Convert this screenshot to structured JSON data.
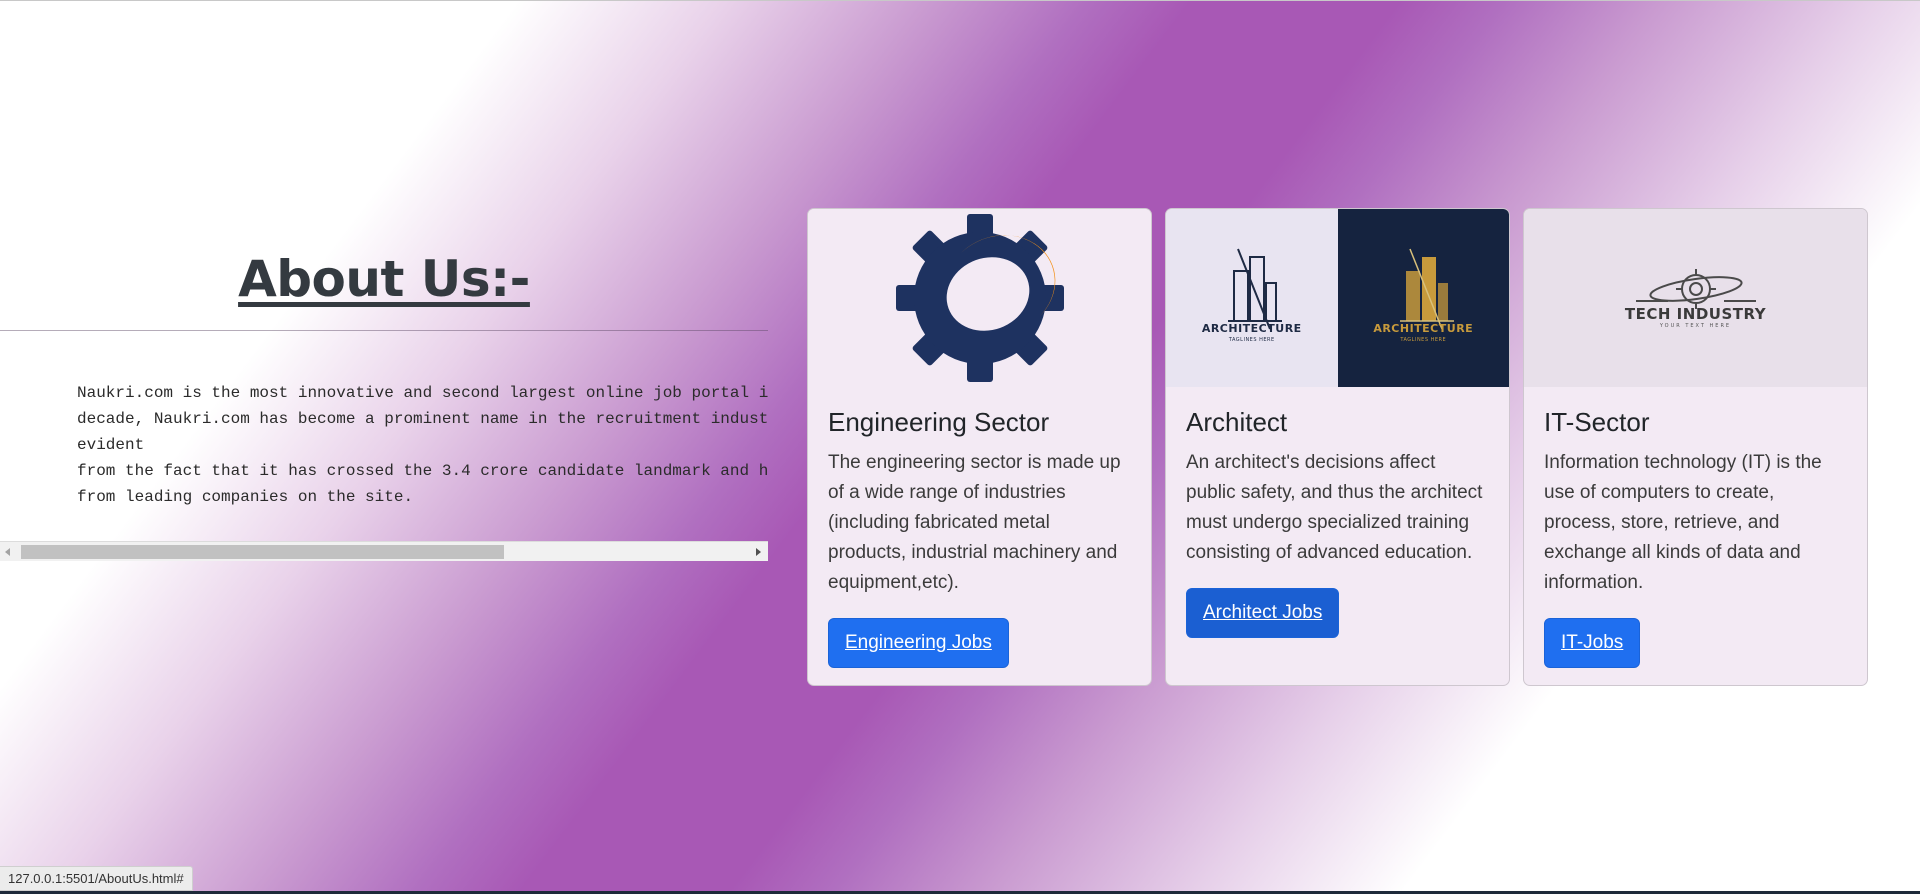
{
  "about": {
    "title": "About Us:-",
    "lines": [
      "Naukri.com is the most innovative and second largest online job portal i",
      "decade, Naukri.com has become a prominent name in the recruitment indust",
      "evident",
      "from the fact that it has crossed the 3.4 crore candidate landmark and h",
      "from leading companies on the site."
    ]
  },
  "cards": [
    {
      "title": "Engineering Sector",
      "text": "The engineering sector is made up of a wide range of industries (including fabricated metal products, industrial machinery and equipment,etc).",
      "button": "Engineering Jobs",
      "image_icon": "gear-icon"
    },
    {
      "title": "Architect",
      "text": "An architect's decisions affect public safety, and thus the architect must undergo specialized training consisting of advanced education.",
      "button": "Architect Jobs",
      "image_logo_text": "ARCHITECTURE",
      "image_logo_subtext": "TAGLINES HERE",
      "image_icon": "building-icon"
    },
    {
      "title": "IT-Sector",
      "text": "Information technology (IT) is the use of computers to create, process, store, retrieve, and exchange all kinds of data and information.",
      "button": "IT-Jobs",
      "image_logo_text": "TECH INDUSTRY",
      "image_logo_subtext": "YOUR TEXT HERE",
      "image_icon": "tech-gear-icon"
    }
  ],
  "status_bar": {
    "url": "127.0.0.1:5501/AboutUs.html#"
  },
  "colors": {
    "accent_purple": "#a858b5",
    "button_blue": "#1f6ff0",
    "gear_navy": "#1e3260",
    "gear_orange": "#f39017",
    "gold": "#c79a3c"
  },
  "scrollbar": {
    "position_fraction": 0
  }
}
